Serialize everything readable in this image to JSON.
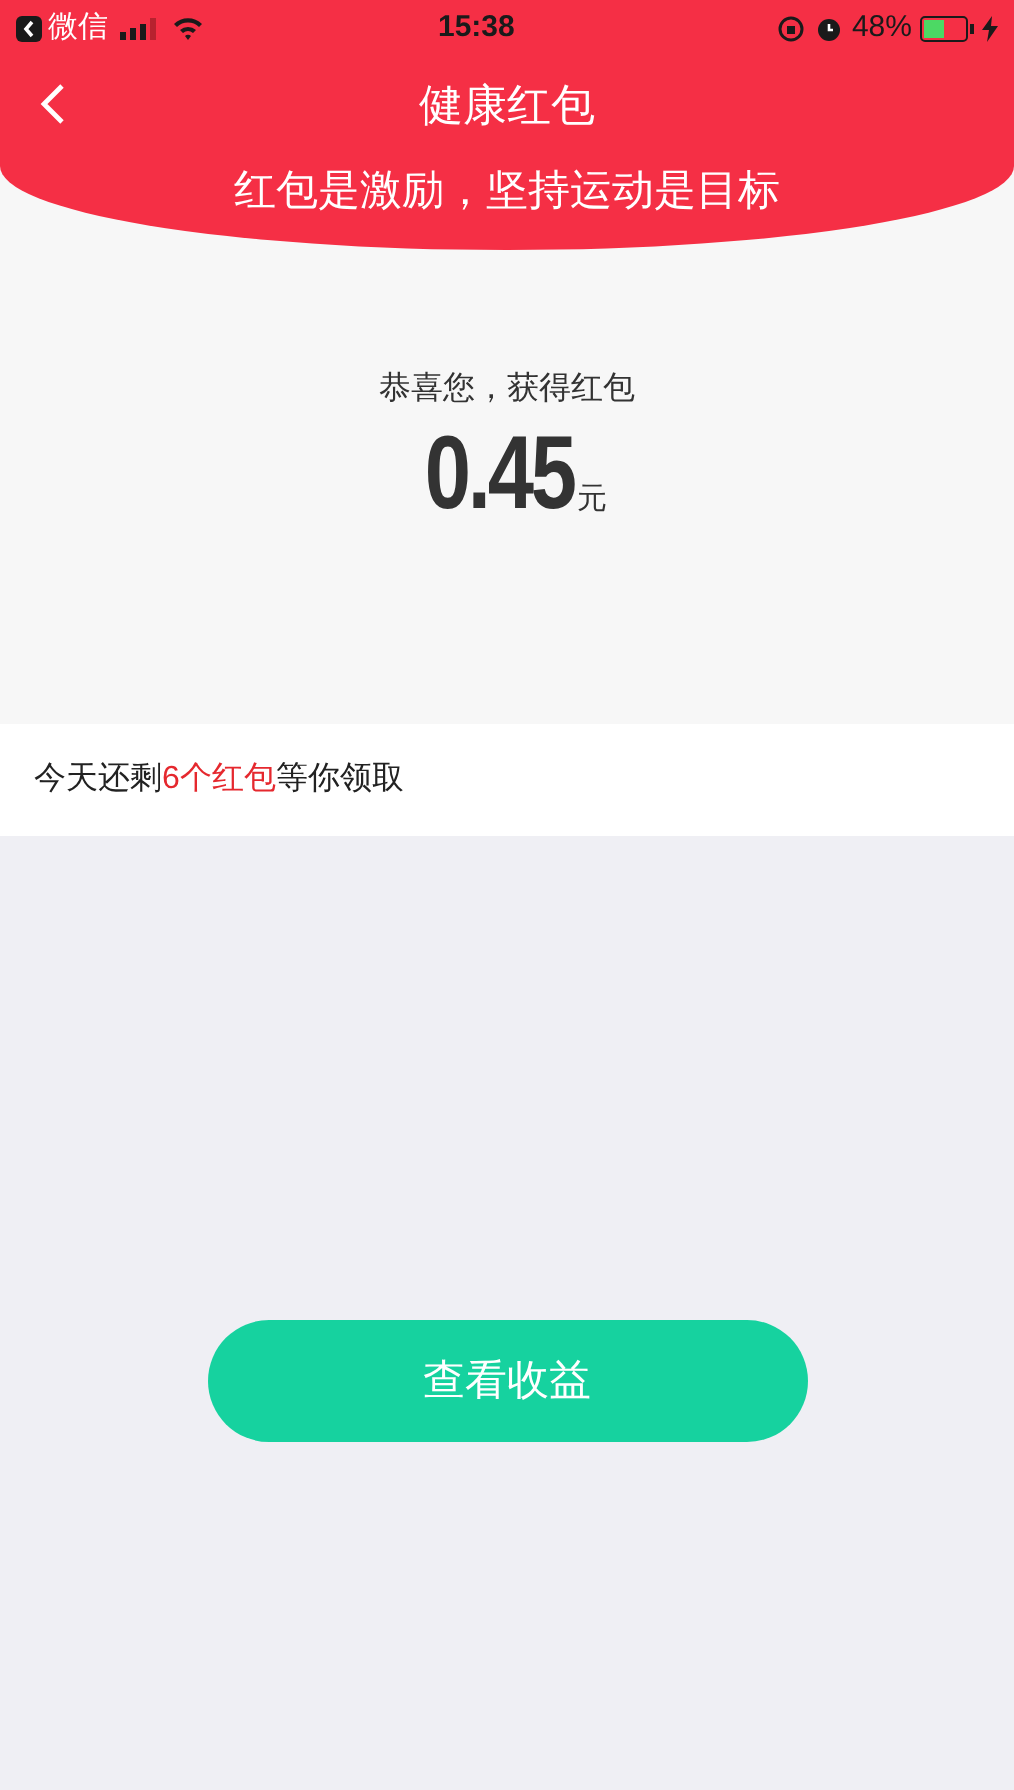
{
  "status_bar": {
    "back_app": "微信",
    "time": "15:38",
    "battery_percent": "48%",
    "charging": true
  },
  "nav": {
    "title": "健康红包"
  },
  "subtitle": "红包是激励，坚持运动是目标",
  "reward": {
    "caption": "恭喜您，获得红包",
    "amount": "0.45",
    "unit": "元"
  },
  "remaining": {
    "prefix": "今天还剩",
    "highlight": "6个红包",
    "suffix": "等你领取"
  },
  "buttons": [
    {
      "label": "查看收益"
    }
  ]
}
